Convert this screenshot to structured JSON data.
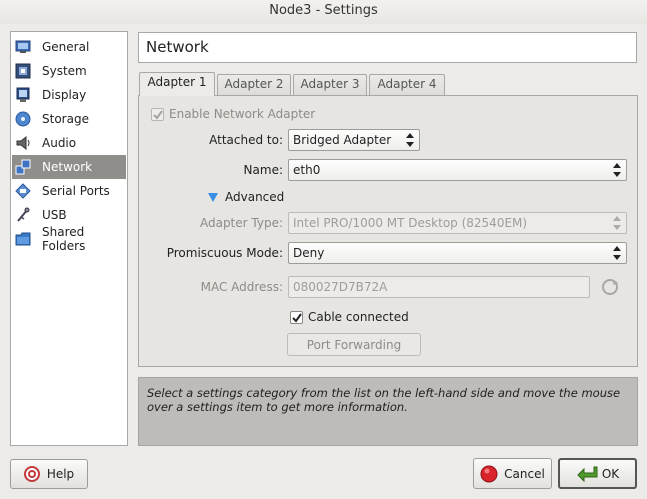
{
  "window": {
    "title": "Node3 - Settings"
  },
  "sidebar": {
    "items": [
      {
        "label": "General",
        "icon": "general-icon"
      },
      {
        "label": "System",
        "icon": "system-icon"
      },
      {
        "label": "Display",
        "icon": "display-icon"
      },
      {
        "label": "Storage",
        "icon": "storage-icon"
      },
      {
        "label": "Audio",
        "icon": "audio-icon"
      },
      {
        "label": "Network",
        "icon": "network-icon",
        "selected": true
      },
      {
        "label": "Serial Ports",
        "icon": "serial-ports-icon"
      },
      {
        "label": "USB",
        "icon": "usb-icon"
      },
      {
        "label": "Shared Folders",
        "icon": "shared-folders-icon"
      }
    ]
  },
  "page": {
    "title": "Network"
  },
  "tabs": [
    {
      "label": "Adapter 1",
      "active": true
    },
    {
      "label": "Adapter 2"
    },
    {
      "label": "Adapter 3"
    },
    {
      "label": "Adapter 4"
    }
  ],
  "adapter": {
    "enable_label": "Enable Network Adapter",
    "enable_checked": true,
    "attached_label": "Attached to:",
    "attached_value": "Bridged Adapter",
    "name_label": "Name:",
    "name_value": "eth0",
    "advanced_label": "Advanced",
    "type_label": "Adapter Type:",
    "type_value": "Intel PRO/1000 MT Desktop (82540EM)",
    "promisc_label": "Promiscuous Mode:",
    "promisc_value": "Deny",
    "mac_label": "MAC Address:",
    "mac_value": "080027D7B72A",
    "cable_label": "Cable connected",
    "cable_checked": true,
    "port_forwarding_label": "Port Forwarding"
  },
  "info": {
    "text": "Select a settings category from the list on the left-hand side and move the mouse over a settings item to get more information."
  },
  "buttons": {
    "help": "Help",
    "cancel": "Cancel",
    "ok": "OK"
  },
  "colors": {
    "selected_bg": "#908e8a",
    "info_bg": "#bdbcb9",
    "advanced_triangle": "#3a8ee6"
  }
}
